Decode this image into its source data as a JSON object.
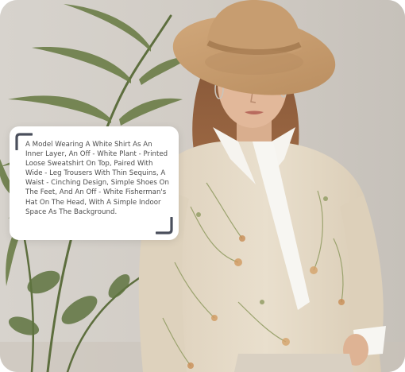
{
  "caption": {
    "text": "A Model Wearing A White Shirt As An Inner Layer, An Off - White Plant - Printed Loose Sweatshirt On Top, Paired With Wide - Leg Trousers With Thin Sequins, A Waist - Cinching Design, Simple Shoes On The Feet, And An Off - White Fisherman's Hat On The Head, With A Simple Indoor Space As The Background.",
    "open_bracket_icon": "corner-bracket-top-left-icon",
    "close_bracket_icon": "corner-bracket-bottom-right-icon"
  },
  "colors": {
    "background": "#d3cec7",
    "card": "#ffffff",
    "caption_text": "#4b4b4b",
    "bracket": "#4a4f5c",
    "hat": "#c49a6c",
    "sweater": "#e6dac6",
    "shirt": "#f7f6f2",
    "plant": "#6e7f4a"
  }
}
